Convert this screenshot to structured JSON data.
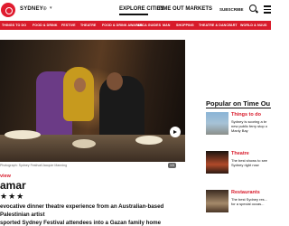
{
  "header": {
    "city": "SYDNEY",
    "nav": [
      "EXPLORE CITIES",
      "TIME OUT MARKETS"
    ],
    "subscribe": "SUBSCRIBE"
  },
  "categories": [
    "THINGS TO DO",
    "FOOD & DRINK",
    "FESTIVE",
    "THEATRE",
    "FOOD & DRINK AWARDS",
    "ARCA GUIDES",
    "MAN",
    "SHOPPING",
    "THEATRE & DANCE",
    "ART",
    "WORLD & NUUS"
  ],
  "article": {
    "caption": "Photograph: Sydney Festival/Jacquie Manning",
    "image_counter": "1/3",
    "section": "view",
    "title": "amar",
    "rating_stars": "★★★",
    "description_lines": [
      "evocative dinner theatre experience from an Australian-based Palestinian artist",
      "sported Sydney Festival attendees into a Gazan family home"
    ]
  },
  "sidebar": {
    "title": "Popular on Time Ou",
    "items": [
      {
        "category": "Things to do",
        "headline": "Sydney is scoring a br new public ferry stop o Manly Bay"
      },
      {
        "category": "Theatre",
        "headline": "The best shows to see Sydney right now"
      },
      {
        "category": "Restaurants",
        "headline": "The best Sydney res... for a special occas..."
      }
    ]
  }
}
